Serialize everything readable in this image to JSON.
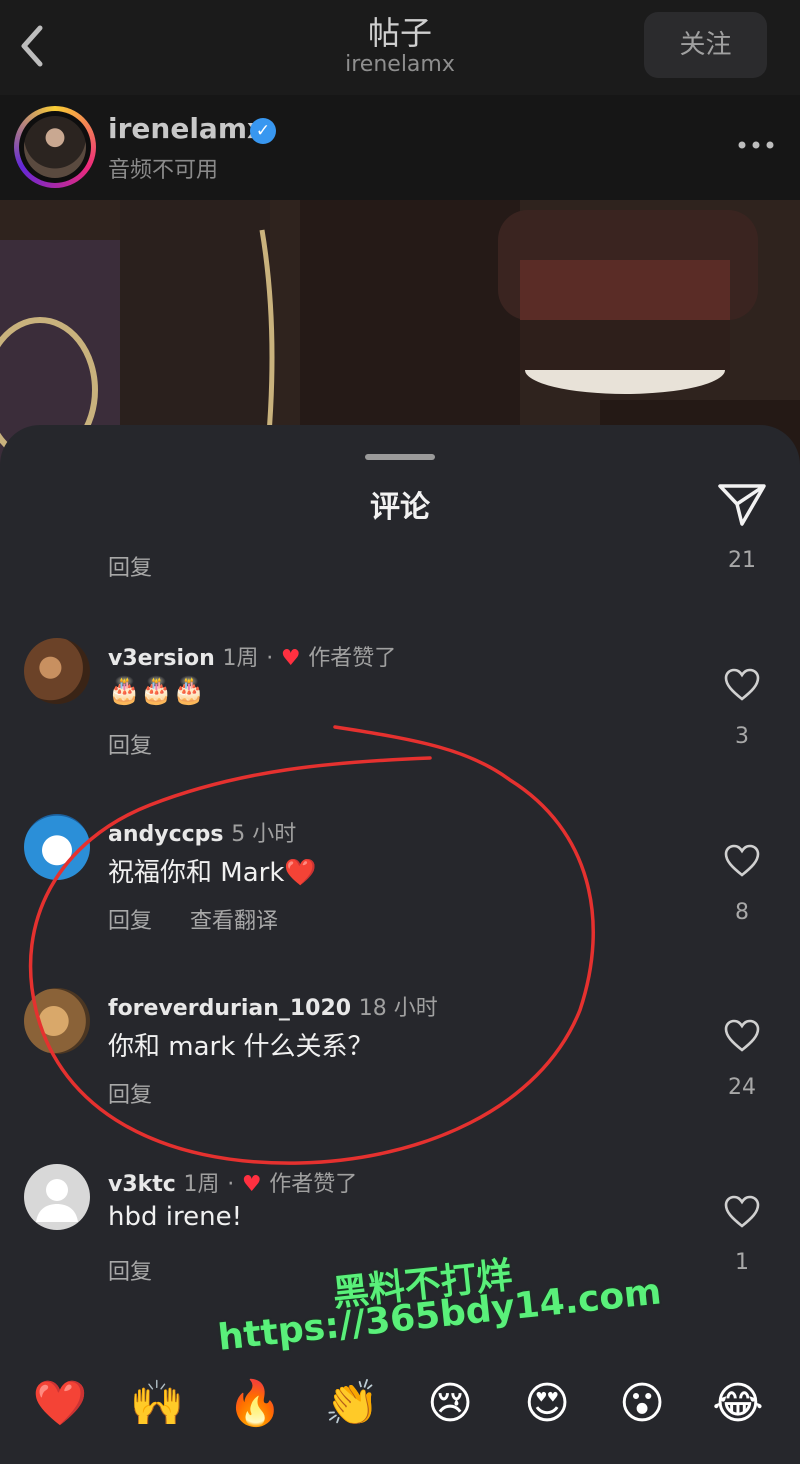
{
  "header": {
    "title": "帖子",
    "subtitle": "irenelamx",
    "follow_label": "关注"
  },
  "post": {
    "username": "irenelamx",
    "verified": true,
    "audio_status": "音频不可用"
  },
  "comments_sheet": {
    "title": "评论",
    "top_partial": {
      "reply_label": "回复",
      "likes": "21"
    },
    "comments": [
      {
        "username": "v3ersion",
        "time": "1周",
        "author_liked_label": "作者赞了",
        "text": "🎂🎂🎂",
        "reply_label": "回复",
        "likes": "3"
      },
      {
        "username": "andyccps",
        "time": "5 小时",
        "text": "祝福你和 Mark❤️",
        "reply_label": "回复",
        "translate_label": "查看翻译",
        "likes": "8"
      },
      {
        "username": "foreverdurian_1020",
        "time": "18 小时",
        "text": "你和 mark 什么关系？",
        "reply_label": "回复",
        "likes": "24"
      },
      {
        "username": "v3ktc",
        "time": "1周",
        "author_liked_label": "作者赞了",
        "text": "hbd irene!",
        "reply_label": "回复",
        "likes": "1"
      }
    ],
    "separator": "·"
  },
  "emoji_bar": [
    "❤️",
    "🙌",
    "🔥",
    "👏",
    "😢",
    "😍",
    "😮",
    "😂"
  ],
  "watermark": {
    "line1": "黑料不打烊",
    "line2": "https://365bdy14.com"
  },
  "colors": {
    "sheet_bg": "#26272c",
    "like_red": "#ff3040",
    "annotation_red": "#e5312f",
    "watermark_green": "#5af07a",
    "verified_blue": "#3897f0"
  }
}
